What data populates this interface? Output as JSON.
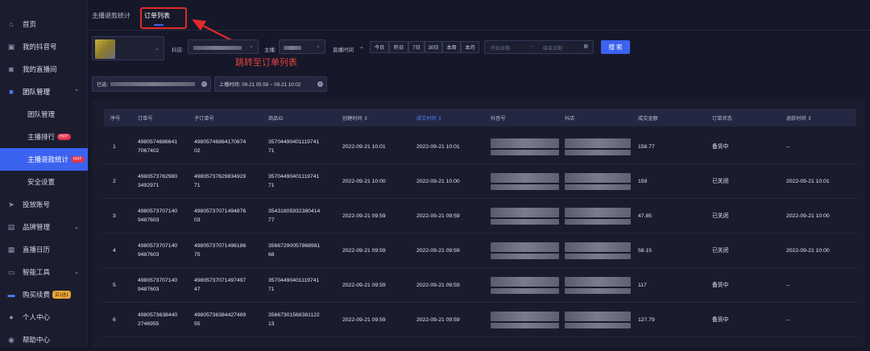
{
  "sidebar": {
    "items": [
      {
        "label": "首页",
        "icon": "home-icon"
      },
      {
        "label": "我的抖音号",
        "icon": "account-icon"
      },
      {
        "label": "我的直播间",
        "icon": "live-room-icon"
      },
      {
        "label": "团队管理",
        "icon": "team-icon"
      },
      {
        "label": "团队管理"
      },
      {
        "label": "主播排行",
        "badge": "HOT"
      },
      {
        "label": "主播退款统计",
        "badge": "HOT"
      },
      {
        "label": "安全设置"
      },
      {
        "label": "投放账号",
        "icon": "ad-icon"
      },
      {
        "label": "品牌管理",
        "icon": "brand-icon"
      },
      {
        "label": "直播日历",
        "icon": "calendar-icon"
      },
      {
        "label": "智能工具",
        "icon": "tool-icon"
      },
      {
        "label": "购买续费",
        "icon": "card-icon",
        "badge": "买1送1"
      },
      {
        "label": "个人中心",
        "icon": "user-icon"
      },
      {
        "label": "帮助中心",
        "icon": "help-icon"
      }
    ]
  },
  "tabs": [
    {
      "label": "主播退款统计"
    },
    {
      "label": "订单列表"
    }
  ],
  "annotation": "跳转至订单列表",
  "filters": {
    "douyin_store_label": "抖店:",
    "anchor_label": "主播:",
    "live_time_label": "直播时间",
    "segments": [
      "今日",
      "昨日",
      "7日",
      "30日",
      "本周",
      "本月"
    ],
    "start_placeholder": "开始日期",
    "end_placeholder": "结束日期",
    "search_label": "搜 索"
  },
  "chips": {
    "selected_label": "已选:",
    "time_range": "上播时间: 09-21 05:59 ~ 09-21 10:02"
  },
  "table": {
    "headers": [
      "序号",
      "订单号",
      "子订单号",
      "商品ID",
      "创建时间",
      "成交时间",
      "抖音号",
      "抖店",
      "成交金额",
      "订单状态",
      "退款时间"
    ],
    "rows": [
      {
        "idx": "1",
        "order": [
          "4980574686641",
          "7067402"
        ],
        "sub": [
          "49805746864170674",
          "02"
        ],
        "pid": [
          "35704490401119741",
          "71"
        ],
        "created": "2022-09-21 10:01",
        "deal": "2022-09-21 10:01",
        "amount": "158.77",
        "status": "备货中",
        "refund": "--"
      },
      {
        "idx": "2",
        "order": [
          "4980573762980",
          "3492971"
        ],
        "sub": [
          "49805737629834929",
          "71"
        ],
        "pid": [
          "35704490401119741",
          "71"
        ],
        "created": "2022-09-21 10:00",
        "deal": "2022-09-21 10:00",
        "amount": "159",
        "status": "已关闭",
        "refund": "2022-09-21 10:01"
      },
      {
        "idx": "3",
        "order": [
          "4980573707140",
          "9487603"
        ],
        "sub": [
          "49805737071494876",
          "03"
        ],
        "pid": [
          "35431805932380414",
          "77"
        ],
        "created": "2022-09-21 09:59",
        "deal": "2022-09-21 09:59",
        "amount": "47.85",
        "status": "已关闭",
        "refund": "2022-09-21 10:00"
      },
      {
        "idx": "4",
        "order": [
          "4980573707140",
          "9487603"
        ],
        "sub": [
          "49805737071496186",
          "75"
        ],
        "pid": [
          "35667290057868981",
          "68"
        ],
        "created": "2022-09-21 09:59",
        "deal": "2022-09-21 09:59",
        "amount": "58.15",
        "status": "已关闭",
        "refund": "2022-09-21 10:00"
      },
      {
        "idx": "5",
        "order": [
          "4980573707140",
          "9487603"
        ],
        "sub": [
          "49805737071497497",
          "47"
        ],
        "pid": [
          "35704490401119741",
          "71"
        ],
        "created": "2022-09-21 09:59",
        "deal": "2022-09-21 09:59",
        "amount": "117",
        "status": "备货中",
        "refund": "--"
      },
      {
        "idx": "6",
        "order": [
          "4980573638440",
          "2746955"
        ],
        "sub": [
          "49805736384427469",
          "55"
        ],
        "pid": [
          "35667301568381122",
          "13"
        ],
        "created": "2022-09-21 09:59",
        "deal": "2022-09-21 09:59",
        "amount": "127.79",
        "status": "备货中",
        "refund": "--"
      }
    ]
  },
  "colors": {
    "accent": "#3c63f0",
    "hot": "#e0344b",
    "annotation": "#e02a2a",
    "promo": "#e4a53a"
  }
}
